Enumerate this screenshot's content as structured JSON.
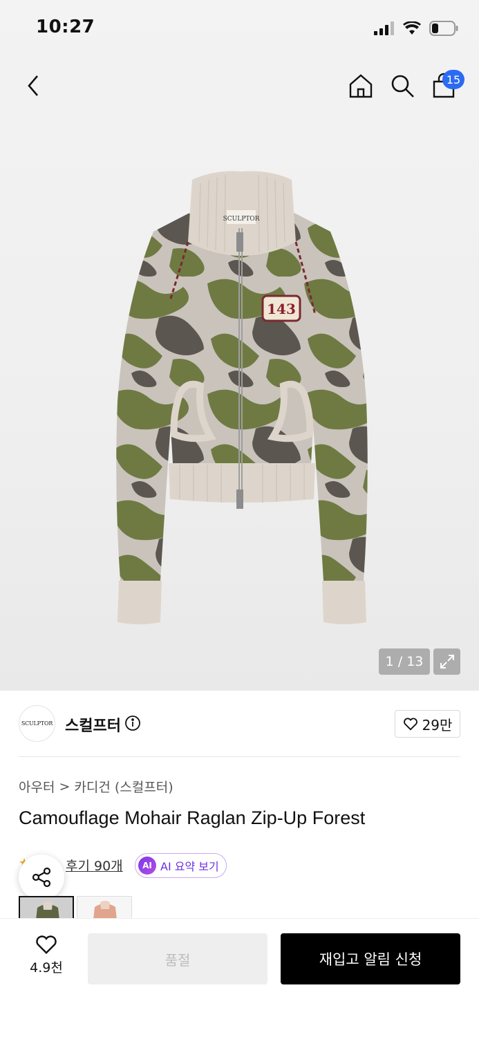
{
  "status": {
    "time": "10:27"
  },
  "header": {
    "cart_count": "15"
  },
  "gallery": {
    "pager": "1 / 13",
    "patch_text": "143",
    "label_text": "SCULPTOR"
  },
  "brand": {
    "name": "스컬프터",
    "logo_text": "SCULPTOR",
    "likes": "29만"
  },
  "breadcrumb": {
    "category": "아우터",
    "separator": ">",
    "sub": "카디건 (스컬프터)"
  },
  "product": {
    "title": "Camouflage Mohair Raglan Zip-Up Forest"
  },
  "reviews": {
    "label": "후기 90개",
    "ai_icon": "AI",
    "ai_label": "AI 요약 보기"
  },
  "bottom": {
    "wish_count": "4.9천",
    "soldout_label": "품절",
    "restock_label": "재입고 알림 신청"
  },
  "colors": {
    "accent_blue": "#2b6bf3",
    "ai_purple": "#7c3aed",
    "primary_black": "#000000",
    "star": "#f5a623"
  }
}
